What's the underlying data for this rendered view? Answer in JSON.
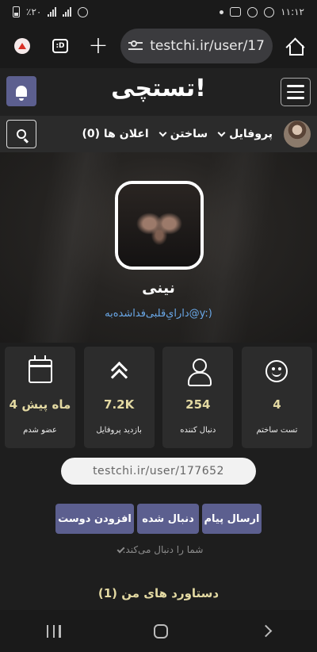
{
  "status_bar": {
    "battery_text": "٪۲۰",
    "time": "۱۱:۱۲"
  },
  "browser": {
    "tab_count_label": ":D",
    "url": "testchi.ir/user/17"
  },
  "site": {
    "logo_text": "تستچی!"
  },
  "nav": {
    "profile_label": "پروفایل",
    "build_label": "ساختن",
    "notifications_label": "اعلان ها (0)"
  },
  "profile": {
    "name": "نینی",
    "bio": "دارایِ‌قلبی‌فداشده‌به@y:)"
  },
  "stats": [
    {
      "icon": "smiley-icon",
      "value": "4",
      "label": "تست ساختم"
    },
    {
      "icon": "user-icon",
      "value": "254",
      "label": "دنبال کننده"
    },
    {
      "icon": "chevrons-up-icon",
      "value": "7.2K",
      "label": "بازدید پروفایل"
    },
    {
      "icon": "calendar-icon",
      "value": "4 ماه پیش",
      "label": "عضو شدم"
    }
  ],
  "profile_url": "testchi.ir/user/177652",
  "actions": {
    "send_message": "ارسال پیام",
    "following": "دنبال شده",
    "add_friend": "افزودن دوست"
  },
  "follows_you_text": "شما را دنبال می‌کند.",
  "achievements_heading": "دستاورد های من (1)",
  "colors": {
    "accent_button": "#5c5f8f",
    "stat_value": "#e3d9a2",
    "bio_link": "#6aa8e8"
  }
}
